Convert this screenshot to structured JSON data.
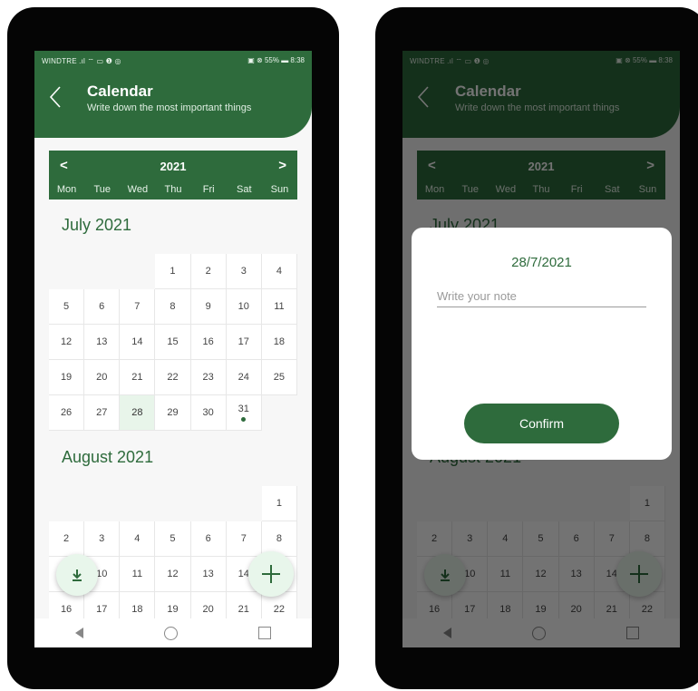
{
  "colors": {
    "brand": "#2e6b3c",
    "today": "#e8f5ea",
    "fab": "#e8f6eb"
  },
  "status": {
    "left": "WINDTRE .ıl ⌔ ▭ ❶ ◎",
    "right": "▣ ⊗ 55% ▬ 8:38"
  },
  "header": {
    "title": "Calendar",
    "subtitle": "Write down the most important things"
  },
  "yearbar": {
    "prev": "<",
    "year": "2021",
    "next": ">"
  },
  "weekdays": [
    "Mon",
    "Tue",
    "Wed",
    "Thu",
    "Fri",
    "Sat",
    "Sun"
  ],
  "months": [
    {
      "title": "July 2021",
      "rows": [
        [
          "",
          "",
          "",
          "1",
          "2",
          "3",
          "4"
        ],
        [
          "5",
          "6",
          "7",
          "8",
          "9",
          "10",
          "11"
        ],
        [
          "12",
          "13",
          "14",
          "15",
          "16",
          "17",
          "18"
        ],
        [
          "19",
          "20",
          "21",
          "22",
          "23",
          "24",
          "25"
        ],
        [
          "26",
          "27",
          "28",
          "29",
          "30",
          "31",
          ""
        ]
      ],
      "today": "28",
      "marked": "31"
    },
    {
      "title": "August 2021",
      "rows": [
        [
          "",
          "",
          "",
          "",
          "",
          "",
          "1"
        ],
        [
          "2",
          "3",
          "4",
          "5",
          "6",
          "7",
          "8"
        ],
        [
          "9",
          "10",
          "11",
          "12",
          "13",
          "14",
          "15"
        ],
        [
          "16",
          "17",
          "18",
          "19",
          "20",
          "21",
          "22"
        ]
      ]
    }
  ],
  "dialog": {
    "date": "28/7/2021",
    "placeholder": "Write your note",
    "confirm": "Confirm"
  },
  "icons": {
    "back": "chevron-left-icon",
    "download": "download-icon",
    "add": "plus-icon",
    "nav": [
      "nav-back-icon",
      "nav-home-icon",
      "nav-recent-icon"
    ]
  }
}
